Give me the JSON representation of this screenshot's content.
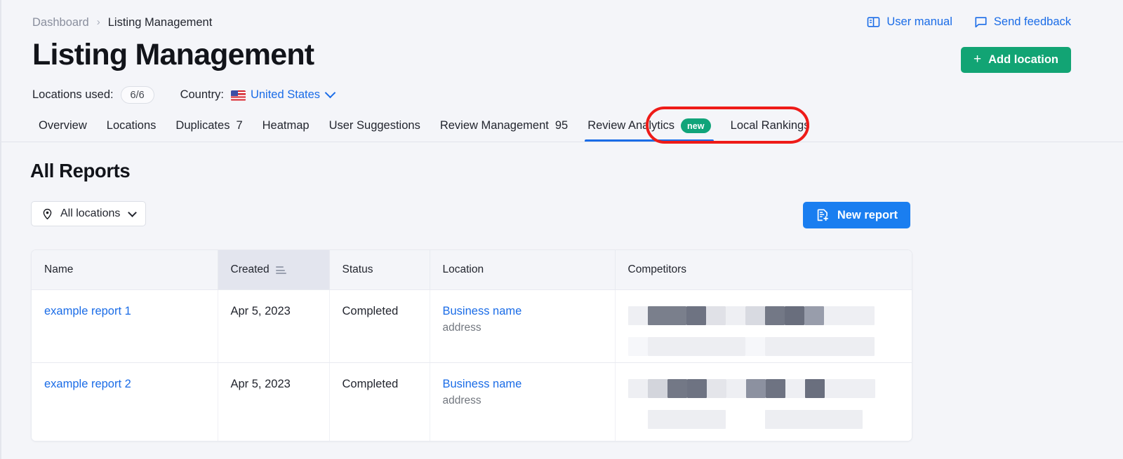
{
  "breadcrumb": {
    "root": "Dashboard",
    "separator": "›",
    "current": "Listing Management"
  },
  "header": {
    "title": "Listing Management",
    "locations_used_label": "Locations used:",
    "locations_used_value": "6/6",
    "country_label": "Country:",
    "country_value": "United States",
    "flag_icon": "us-flag-icon",
    "country_caret_icon": "chevron-down-icon"
  },
  "top_links": [
    {
      "label": "User manual",
      "icon": "book-icon"
    },
    {
      "label": "Send feedback",
      "icon": "speech-bubble-icon"
    }
  ],
  "add_location": {
    "label": "Add location",
    "icon": "plus-icon",
    "color": "#12a474"
  },
  "tabs": [
    {
      "label": "Overview",
      "count": "",
      "active": false,
      "badge": ""
    },
    {
      "label": "Locations",
      "count": "",
      "active": false,
      "badge": ""
    },
    {
      "label": "Duplicates",
      "count": "7",
      "active": false,
      "badge": ""
    },
    {
      "label": "Heatmap",
      "count": "",
      "active": false,
      "badge": ""
    },
    {
      "label": "User Suggestions",
      "count": "",
      "active": false,
      "badge": ""
    },
    {
      "label": "Review Management",
      "count": "95",
      "active": false,
      "badge": ""
    },
    {
      "label": "Review Analytics",
      "count": "",
      "active": true,
      "badge": "new"
    },
    {
      "label": "Local Rankings",
      "count": "",
      "active": false,
      "badge": ""
    }
  ],
  "annotation": {
    "shape": "red-rounded-rectangle",
    "target": "Review Analytics",
    "color": "#ee1b18"
  },
  "main": {
    "section_title": "All Reports",
    "location_filter": {
      "label": "All locations",
      "icon": "map-pin-icon",
      "caret_icon": "chevron-down-icon"
    },
    "new_report": {
      "label": "New report",
      "icon": "document-plus-icon",
      "color": "#1a7ef0"
    }
  },
  "table": {
    "columns": [
      {
        "label": "Name",
        "sorted": false,
        "sort_icon": ""
      },
      {
        "label": "Created",
        "sorted": true,
        "sort_icon": "sort-descending-icon"
      },
      {
        "label": "Status",
        "sorted": false,
        "sort_icon": ""
      },
      {
        "label": "Location",
        "sorted": false,
        "sort_icon": ""
      },
      {
        "label": "Competitors",
        "sorted": false,
        "sort_icon": ""
      }
    ],
    "rows": [
      {
        "name": "example report 1",
        "created": "Apr 5, 2023",
        "status": "Completed",
        "location_name": "Business name",
        "location_address": "address",
        "competitors_redacted": true
      },
      {
        "name": "example report 2",
        "created": "Apr 5, 2023",
        "status": "Completed",
        "location_name": "Business name",
        "location_address": "address",
        "competitors_redacted": true
      }
    ]
  },
  "colors": {
    "link": "#1a6ce7",
    "accent_blue": "#1a7ef0",
    "accent_green": "#12a474",
    "page_bg": "#f4f5f9",
    "annotation_red": "#ee1b18"
  }
}
